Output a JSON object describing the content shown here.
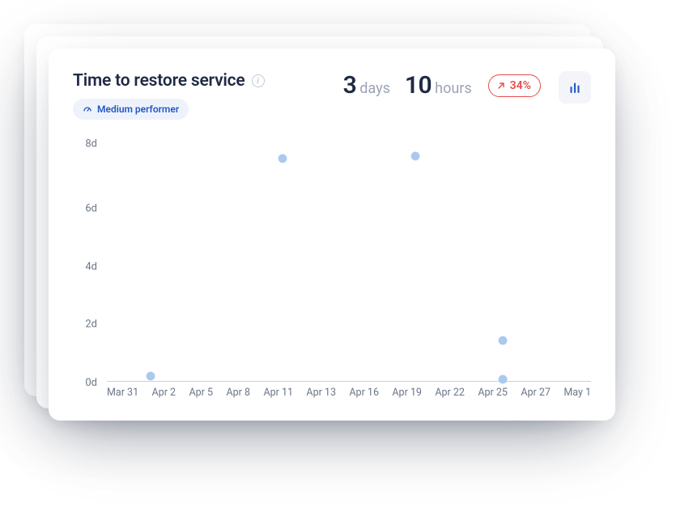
{
  "card": {
    "title": "Time to restore service",
    "badge_label": "Medium performer",
    "metric": {
      "days_value": "3",
      "days_unit": "days",
      "hours_value": "10",
      "hours_unit": "hours"
    },
    "trend_pct": "34%"
  },
  "chart_data": {
    "type": "scatter",
    "title": "Time to restore service",
    "xlabel": "",
    "ylabel": "",
    "ylim": [
      0,
      8
    ],
    "y_ticks": [
      "8d",
      "6d",
      "4d",
      "2d",
      "0d"
    ],
    "x_ticks": [
      "Mar 31",
      "Apr 2",
      "Apr 5",
      "Apr 8",
      "Apr 11",
      "Apr 13",
      "Apr 16",
      "Apr 19",
      "Apr 22",
      "Apr 25",
      "Apr 27",
      "May 1"
    ],
    "series": [
      {
        "name": "Time to restore",
        "points": [
          {
            "x": "Apr 2",
            "y": 0.15
          },
          {
            "x": "Apr 11",
            "y": 7.4
          },
          {
            "x": "Apr 19",
            "y": 7.5
          },
          {
            "x": "Apr 25",
            "y": 1.35
          },
          {
            "x": "Apr 25",
            "y": 0.05
          }
        ]
      }
    ]
  }
}
